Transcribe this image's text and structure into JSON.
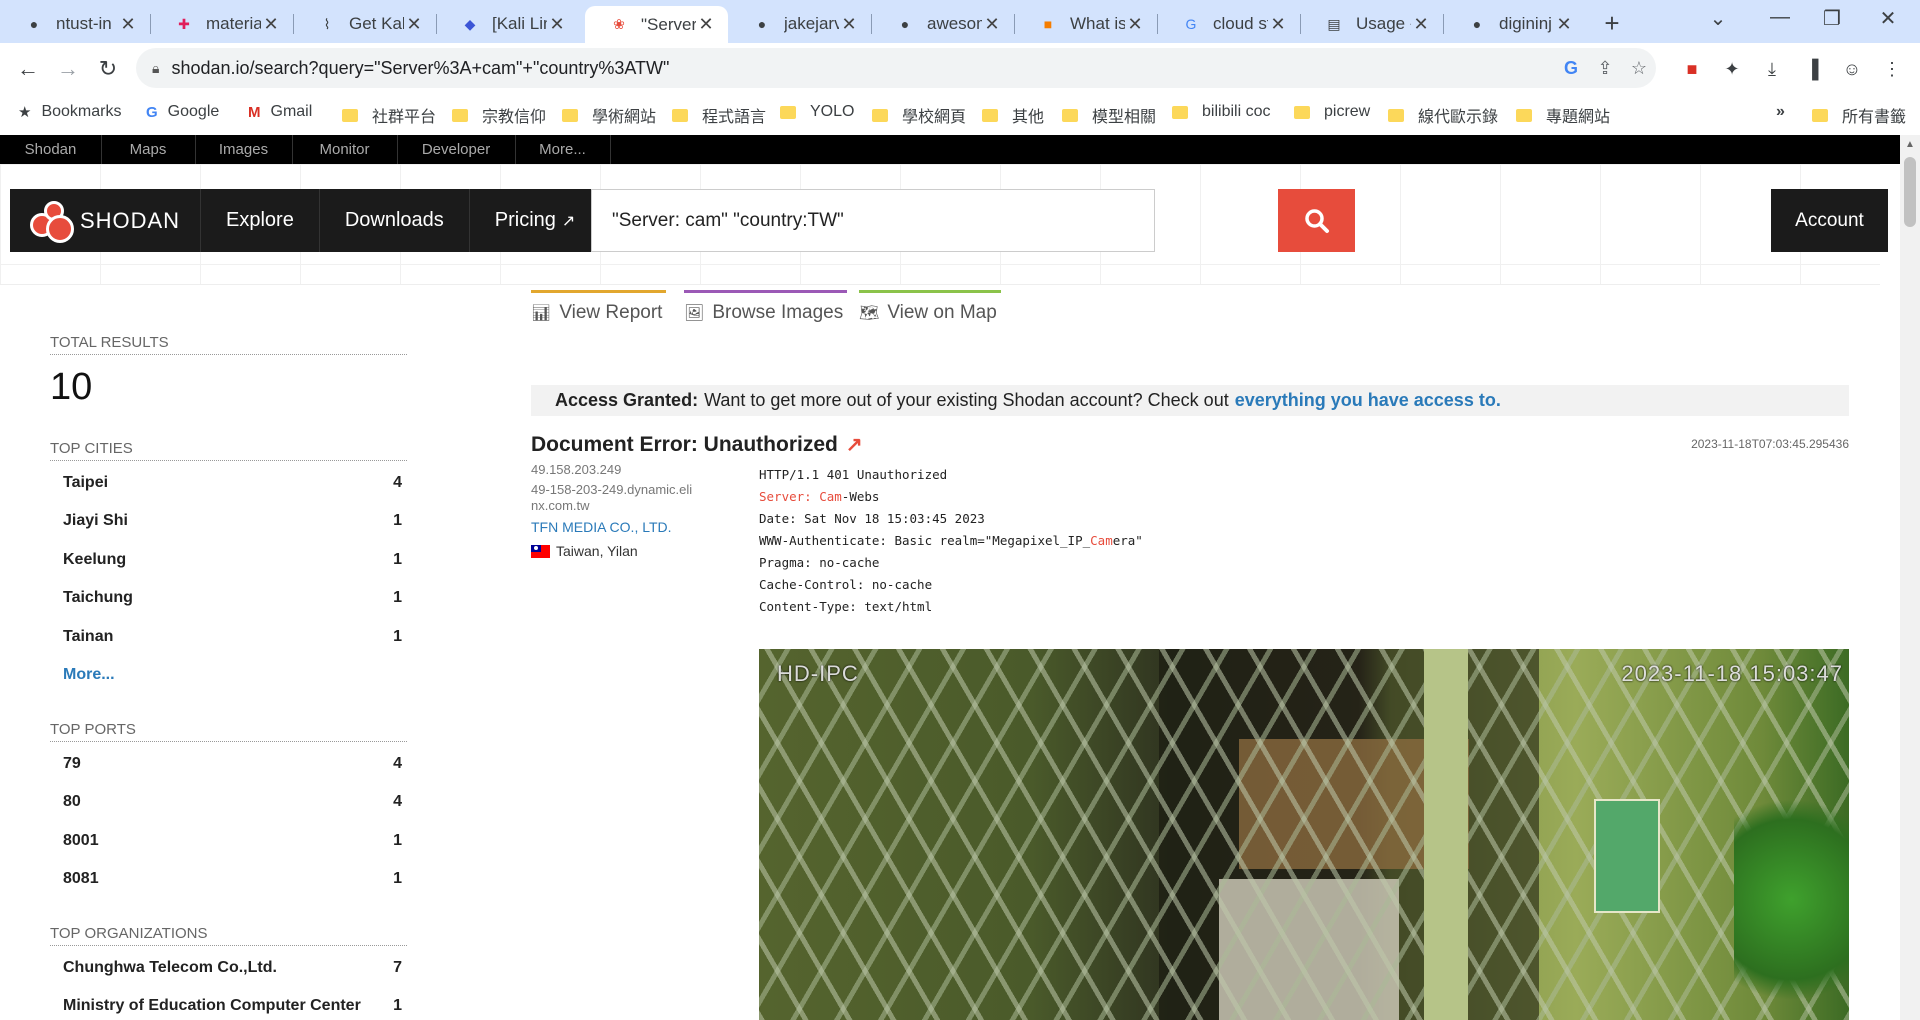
{
  "browser": {
    "tabs": [
      {
        "label": "ntust-in",
        "icon": "github-icon"
      },
      {
        "label": "material",
        "icon": "slack-icon"
      },
      {
        "label": "Get Kali",
        "icon": "kali-icon"
      },
      {
        "label": "[Kali Lin",
        "icon": "discord-icon"
      },
      {
        "label": "\"Server",
        "icon": "shodan-icon"
      },
      {
        "label": "jakejarv",
        "icon": "github-icon"
      },
      {
        "label": "awesom",
        "icon": "github-icon"
      },
      {
        "label": "What is",
        "icon": "blog-icon"
      },
      {
        "label": "cloud st",
        "icon": "google-icon"
      },
      {
        "label": "Usage -",
        "icon": "docs-icon"
      },
      {
        "label": "digininj",
        "icon": "github-icon"
      }
    ],
    "url": "shodan.io/search?query=\"Server%3A+cam\"+\"country%3ATW\"",
    "bookmarks": [
      {
        "label": "Bookmarks",
        "type": "star"
      },
      {
        "label": "Google",
        "type": "google"
      },
      {
        "label": "Gmail",
        "type": "gmail"
      },
      {
        "label": "社群平台",
        "type": "folder"
      },
      {
        "label": "宗教信仰",
        "type": "folder"
      },
      {
        "label": "學術網站",
        "type": "folder"
      },
      {
        "label": "程式語言",
        "type": "folder"
      },
      {
        "label": "YOLO",
        "type": "folder"
      },
      {
        "label": "學校網頁",
        "type": "folder"
      },
      {
        "label": "其他",
        "type": "folder"
      },
      {
        "label": "模型相關",
        "type": "folder"
      },
      {
        "label": "bilibili coc",
        "type": "folder"
      },
      {
        "label": "picrew",
        "type": "folder"
      },
      {
        "label": "線代歐示錄",
        "type": "folder"
      },
      {
        "label": "專題網站",
        "type": "folder"
      }
    ],
    "bookmarks_overflow": "»",
    "all_bookmarks": "所有書籤"
  },
  "shodan": {
    "topnav": [
      "Shodan",
      "Maps",
      "Images",
      "Monitor",
      "Developer",
      "More..."
    ],
    "logo": "SHODAN",
    "nav": {
      "explore": "Explore",
      "downloads": "Downloads",
      "pricing": "Pricing"
    },
    "search_value": "\"Server: cam\" \"country:TW\"",
    "account": "Account"
  },
  "sidebar": {
    "total_results_label": "TOTAL RESULTS",
    "total_results": "10",
    "top_cities_label": "TOP CITIES",
    "cities": [
      {
        "name": "Taipei",
        "count": "4"
      },
      {
        "name": "Jiayi Shi",
        "count": "1"
      },
      {
        "name": "Keelung",
        "count": "1"
      },
      {
        "name": "Taichung",
        "count": "1"
      },
      {
        "name": "Tainan",
        "count": "1"
      }
    ],
    "more": "More...",
    "top_ports_label": "TOP PORTS",
    "ports": [
      {
        "name": "79",
        "count": "4"
      },
      {
        "name": "80",
        "count": "4"
      },
      {
        "name": "8001",
        "count": "1"
      },
      {
        "name": "8081",
        "count": "1"
      }
    ],
    "top_orgs_label": "TOP ORGANIZATIONS",
    "orgs": [
      {
        "name": "Chunghwa Telecom Co.,Ltd.",
        "count": "7"
      },
      {
        "name": "Ministry of Education Computer Center",
        "count": "1"
      }
    ]
  },
  "main": {
    "tabs": {
      "view_report": "View Report",
      "browse_images": "Browse Images",
      "view_on_map": "View on Map"
    },
    "tab_colors": {
      "view_report": "#e2a72e",
      "browse_images": "#9b59b6",
      "view_on_map": "#8bc34a"
    },
    "banner": {
      "strong": "Access Granted:",
      "text": "Want to get more out of your existing Shodan account? Check out",
      "link": "everything you have access to."
    },
    "result": {
      "title": "Document Error: Unauthorized",
      "timestamp": "2023-11-18T07:03:45.295436",
      "ip": "49.158.203.249",
      "hostname_line1": "49-158-203-249.dynamic.eli",
      "hostname_line2": "nx.com.tw",
      "org": "TFN MEDIA CO., LTD.",
      "location": "Taiwan, Yilan",
      "http_lines": {
        "status": "HTTP/1.1 401 Unauthorized",
        "server_key": "Server: ",
        "server_hl": "Cam",
        "server_rest": "-Webs",
        "date": "Date: Sat Nov 18 15:03:45 2023",
        "auth_pre": "WWW-Authenticate: Basic realm=\"Megapixel_IP_",
        "auth_hl": "Cam",
        "auth_post": "era\"",
        "pragma": "Pragma: no-cache",
        "cache": "Cache-Control: no-cache",
        "ctype": "Content-Type: text/html"
      },
      "screenshot": {
        "osd_left": "HD-IPC",
        "osd_right": "2023-11-18  15:03:47"
      }
    }
  },
  "colors": {
    "shodan_red": "#e74c3c",
    "link_blue": "#2a7ab9",
    "tab_bg": "#d3e3fd"
  }
}
